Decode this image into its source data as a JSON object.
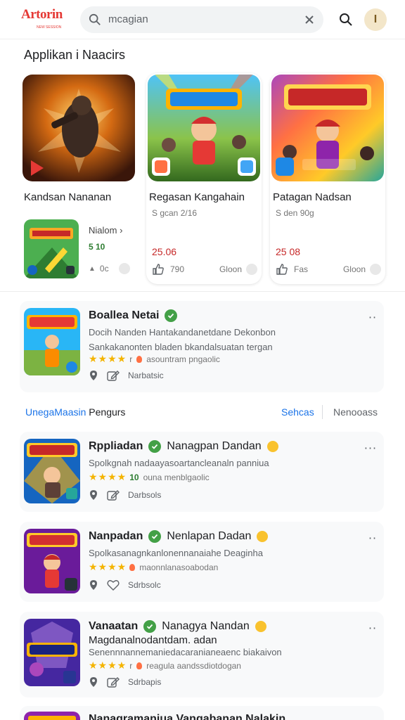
{
  "header": {
    "logo_text": "Artorin",
    "logo_sub": "NEW SESSION",
    "search_placeholder": "mcagian",
    "search_value": "mcagian",
    "avatar_letter": "I"
  },
  "section": {
    "title": "Applikan i Naacirs",
    "cards": [
      {
        "title": "Kandsan Nananan",
        "mini_label": "Nialom",
        "mini_value": "5 10",
        "mini_foot": "0c"
      },
      {
        "title": "Regasan Kangahain",
        "meta": "S gcan 2/16",
        "price": "25.06",
        "foot_count": "790",
        "foot_label": "Gloon"
      },
      {
        "title": "Patagan Nadsan",
        "meta": "S den 90g",
        "price": "25 08",
        "foot_count": "Fas",
        "foot_label": "Gloon"
      }
    ]
  },
  "featured": {
    "title": "Boallea Netai",
    "desc1": "Docih Nanden Hantakandanetdane Dekonbon",
    "desc2": "Sankakanonten bladen bkandalsuatan tergan",
    "rating_text": "asountram pngaolic",
    "action_label": "Narbatsic"
  },
  "tabs": {
    "main_blue": "UnegaMaasin",
    "main_rest": " Pengurs",
    "active": "Sehcas",
    "other": "Nenooass"
  },
  "list": [
    {
      "title": "Rppliadan",
      "title_ext": "Nanagpan Dandan",
      "desc1": "Spolkgnah nadaayasoartancleanaln panniua",
      "rating_num": "10",
      "rating_text": "ouna menblgaolic",
      "action_label": "Darbsols"
    },
    {
      "title": "Nanpadan",
      "title_ext": "Nenlapan Dadan",
      "desc1": "Spolkasanagnkanlonennanaiahe Deaginha",
      "rating_text": "maonnlanasoabodan",
      "action_label": "Sdrbsolc"
    },
    {
      "title": "Vanaatan",
      "title_ext": "Nanagya Nandan",
      "desc_bold": "Magdanalnodantdam. adan",
      "desc1": "Senennnannemaniedacaranianeaenc biakaivon",
      "rating_text": "reagula aandssdiotdogan",
      "action_label": "Sdrbapis"
    }
  ],
  "partial": {
    "title": "Nanagramaniua Vangabanan Nalakin"
  },
  "colors": {
    "accent": "#1a73e8",
    "price": "#c62828",
    "verified": "#43a047",
    "star": "#f4b400",
    "logo": "#e53935"
  }
}
